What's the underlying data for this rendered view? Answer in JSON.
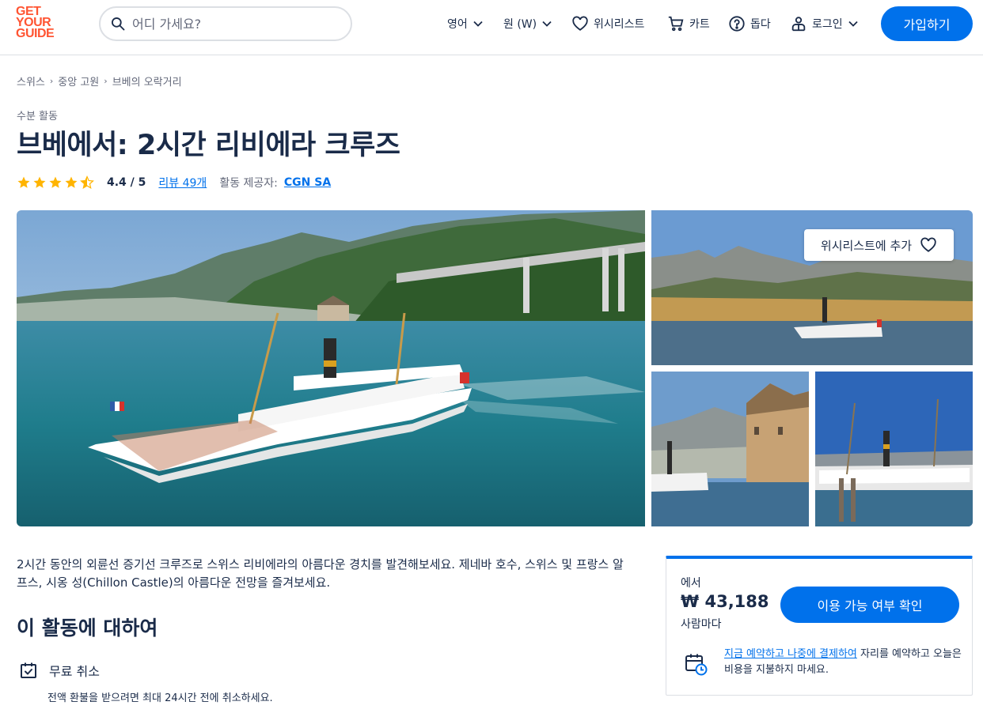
{
  "header": {
    "logo": [
      "GET",
      "YOUR",
      "GUIDE"
    ],
    "search_placeholder": "어디 가세요?",
    "nav": {
      "language": "영어",
      "currency": "원 (W)",
      "wishlist": "위시리스트",
      "cart": "카트",
      "help": "돕다",
      "login": "로그인"
    },
    "signup_label": "가입하기"
  },
  "breadcrumb": [
    "스위스",
    "중앙 고원",
    "브베의 오락거리"
  ],
  "category": "수분 활동",
  "title": "브베에서: 2시간 리비에라 크루즈",
  "rating": {
    "value": 4.4,
    "value_label": "4.4 / 5",
    "reviews_label": "리뷰 49개",
    "provider_label": "활동 제공자:",
    "provider_name": "CGN SA"
  },
  "gallery": {
    "wishlist_add_label": "위시리스트에 추가"
  },
  "description": "2시간 동안의 외륜선 증기선 크루즈로 스위스 리비에라의 아름다운 경치를 발견해보세요. 제네바 호수, 스위스 및 프랑스 알프스, 시옹 성(Chillon Castle)의 아름다운 전망을 즐겨보세요.",
  "about": {
    "title": "이 활동에 대하여",
    "free_cancel_title": "무료 취소",
    "free_cancel_desc": "전액 환불을 받으려면 최대 24시간 전에 취소하세요."
  },
  "booking": {
    "from_label": "에서",
    "price": "₩ 43,188",
    "per_label": "사람마다",
    "check_button": "이용 가능 여부 확인",
    "reserve_link": "지금 예약하고 나중에 결제하여",
    "reserve_text": " 자리를 예약하고 오늘은 비용을 지불하지 마세요."
  },
  "colors": {
    "brand": "#ff5533",
    "accent": "#0071eb",
    "text": "#1a2b49",
    "star": "#ffb400"
  }
}
